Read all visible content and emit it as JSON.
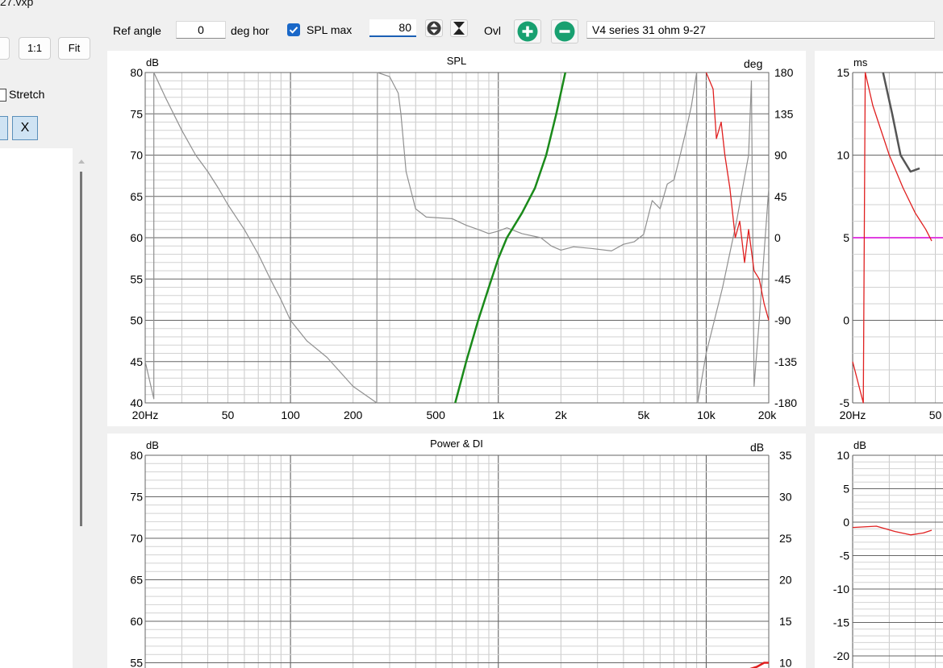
{
  "window": {
    "title_fragment": "27.vxp"
  },
  "toolbar": {
    "ref_angle_label": "Ref angle",
    "ref_angle_value": "0",
    "deg_hor_label": "deg hor",
    "spl_max_checked": true,
    "spl_max_label": "SPL max",
    "spl_max_value": "80",
    "ovl_label": "Ovl",
    "description_value": "V4 series 31 ohm 9-27"
  },
  "sidebar": {
    "btn_partial": "",
    "btn_1to1": "1:1",
    "btn_fit": "Fit",
    "stretch_label": "Stretch",
    "x_button": "X"
  },
  "colors": {
    "gray_curve": "#909090",
    "green_curve": "#1a8a1a",
    "red_curve": "#e02020",
    "magenta": "#e040e0",
    "dark_curve": "#555555"
  },
  "charts": {
    "spl": {
      "title": "SPL",
      "left_unit": "dB",
      "right_unit": "deg",
      "y_ticks": [
        "80",
        "75",
        "70",
        "65",
        "60",
        "55",
        "50",
        "45",
        "40"
      ],
      "r_ticks": [
        "180",
        "135",
        "90",
        "45",
        "0",
        "-45",
        "-90",
        "-135",
        "-180"
      ],
      "x_ticks": [
        "20Hz",
        "50",
        "100",
        "200",
        "500",
        "1k",
        "2k",
        "5k",
        "10k",
        "20k"
      ]
    },
    "power": {
      "title": "Power & DI",
      "left_unit": "dB",
      "right_unit": "dB",
      "y_ticks": [
        "80",
        "75",
        "70",
        "65",
        "60",
        "55"
      ],
      "r_ticks": [
        "35",
        "30",
        "25",
        "20",
        "15",
        "10"
      ]
    },
    "delay": {
      "unit": "ms",
      "y_ticks": [
        "15",
        "10",
        "5",
        "0",
        "-5"
      ],
      "x_ticks": [
        "20Hz",
        "50"
      ]
    },
    "small": {
      "unit": "dB",
      "y_ticks": [
        "10",
        "5",
        "0",
        "-5",
        "-10",
        "-15",
        "-20"
      ]
    }
  },
  "chart_data": [
    {
      "type": "line",
      "title": "SPL",
      "ylabel": "dB",
      "y2label": "deg",
      "xscale": "log",
      "xlim": [
        20,
        20000
      ],
      "ylim": [
        40,
        80
      ],
      "y2lim": [
        -180,
        180
      ],
      "series": [
        {
          "values": [
            [
              20,
              45
            ],
            [
              22,
              40.5
            ],
            [
              22,
              80
            ],
            [
              25,
              77
            ],
            [
              30,
              73
            ],
            [
              35,
              70
            ],
            [
              40,
              68
            ],
            [
              45,
              66
            ],
            [
              50,
              64
            ],
            [
              60,
              61
            ],
            [
              70,
              58
            ],
            [
              80,
              55
            ],
            [
              90,
              52.5
            ],
            [
              100,
              50
            ],
            [
              120,
              47.5
            ],
            [
              150,
              45.5
            ],
            [
              200,
              42
            ],
            [
              250,
              40.3
            ],
            [
              260,
              40
            ],
            [
              262,
              80
            ],
            [
              300,
              79.5
            ],
            [
              330,
              77.5
            ],
            [
              340,
              75
            ],
            [
              360,
              68
            ],
            [
              400,
              63.5
            ],
            [
              450,
              62.5
            ],
            [
              600,
              62.3
            ],
            [
              700,
              61.5
            ],
            [
              800,
              61
            ],
            [
              900,
              60.5
            ],
            [
              1000,
              60.8
            ],
            [
              1100,
              61.2
            ],
            [
              1300,
              60.5
            ],
            [
              1600,
              60
            ],
            [
              1800,
              59
            ],
            [
              2000,
              58.5
            ],
            [
              2300,
              58.9
            ],
            [
              2800,
              58.7
            ],
            [
              3500,
              58.4
            ],
            [
              4000,
              59.2
            ],
            [
              4500,
              59.5
            ],
            [
              5000,
              60.4
            ],
            [
              5500,
              64.5
            ],
            [
              6000,
              63.5
            ],
            [
              6500,
              66.5
            ],
            [
              7000,
              67
            ],
            [
              7500,
              70
            ],
            [
              8000,
              73
            ],
            [
              8500,
              76
            ],
            [
              9000,
              80
            ],
            [
              9100,
              40
            ],
            [
              10000,
              46
            ],
            [
              12000,
              54
            ],
            [
              14000,
              62
            ],
            [
              16000,
              70
            ],
            [
              16500,
              79
            ],
            [
              17000,
              42
            ],
            [
              18000,
              50
            ],
            [
              20000,
              66
            ]
          ]
        },
        {
          "values": [
            [
              620,
              40
            ],
            [
              700,
              45
            ],
            [
              800,
              50
            ],
            [
              900,
              54
            ],
            [
              1000,
              57.5
            ],
            [
              1100,
              60
            ],
            [
              1300,
              63
            ],
            [
              1500,
              66
            ],
            [
              1700,
              70
            ],
            [
              1900,
              75
            ],
            [
              2100,
              80
            ]
          ]
        },
        {
          "values": [
            [
              10000,
              80
            ],
            [
              10800,
              78
            ],
            [
              11200,
              72
            ],
            [
              11800,
              74
            ],
            [
              12300,
              70
            ],
            [
              13000,
              66
            ],
            [
              13800,
              60
            ],
            [
              14500,
              62
            ],
            [
              15300,
              57
            ],
            [
              16000,
              61
            ],
            [
              17000,
              56
            ],
            [
              18000,
              55
            ],
            [
              19000,
              52
            ],
            [
              20000,
              50
            ]
          ]
        }
      ]
    },
    {
      "type": "line",
      "title": "Power & DI",
      "ylabel": "dB",
      "y2label": "dB",
      "xscale": "log",
      "xlim": [
        20,
        20000
      ],
      "ylim": [
        54,
        80
      ],
      "y2lim": [
        9,
        35
      ],
      "series": [
        {
          "values": [
            [
              16000,
              54.2
            ],
            [
              17500,
              54.5
            ],
            [
              19000,
              55
            ],
            [
              20000,
              55
            ]
          ]
        }
      ]
    },
    {
      "type": "line",
      "ylabel": "ms",
      "xscale": "log",
      "xlim": [
        20,
        70
      ],
      "ylim": [
        -5,
        15
      ],
      "series": [
        {
          "values": [
            [
              20,
              -2.5
            ],
            [
              22.5,
              -5
            ],
            [
              23,
              15
            ],
            [
              25,
              13
            ],
            [
              30,
              10
            ],
            [
              35,
              8
            ],
            [
              40,
              6.5
            ],
            [
              45,
              5.5
            ],
            [
              48,
              4.8
            ]
          ]
        },
        {
          "values": [
            [
              28,
              15
            ],
            [
              31,
              12.5
            ],
            [
              34,
              10
            ],
            [
              38,
              9
            ],
            [
              42,
              9.2
            ]
          ]
        },
        {
          "values": [
            [
              20,
              5
            ],
            [
              70,
              5
            ]
          ]
        }
      ]
    },
    {
      "type": "line",
      "ylabel": "dB",
      "xscale": "log",
      "xlim": [
        20,
        70
      ],
      "ylim": [
        -22,
        10
      ],
      "series": [
        {
          "values": [
            [
              20,
              -0.8
            ],
            [
              26,
              -0.6
            ],
            [
              32,
              -1.4
            ],
            [
              38,
              -1.9
            ],
            [
              44,
              -1.6
            ],
            [
              48,
              -1.2
            ]
          ]
        }
      ]
    }
  ]
}
